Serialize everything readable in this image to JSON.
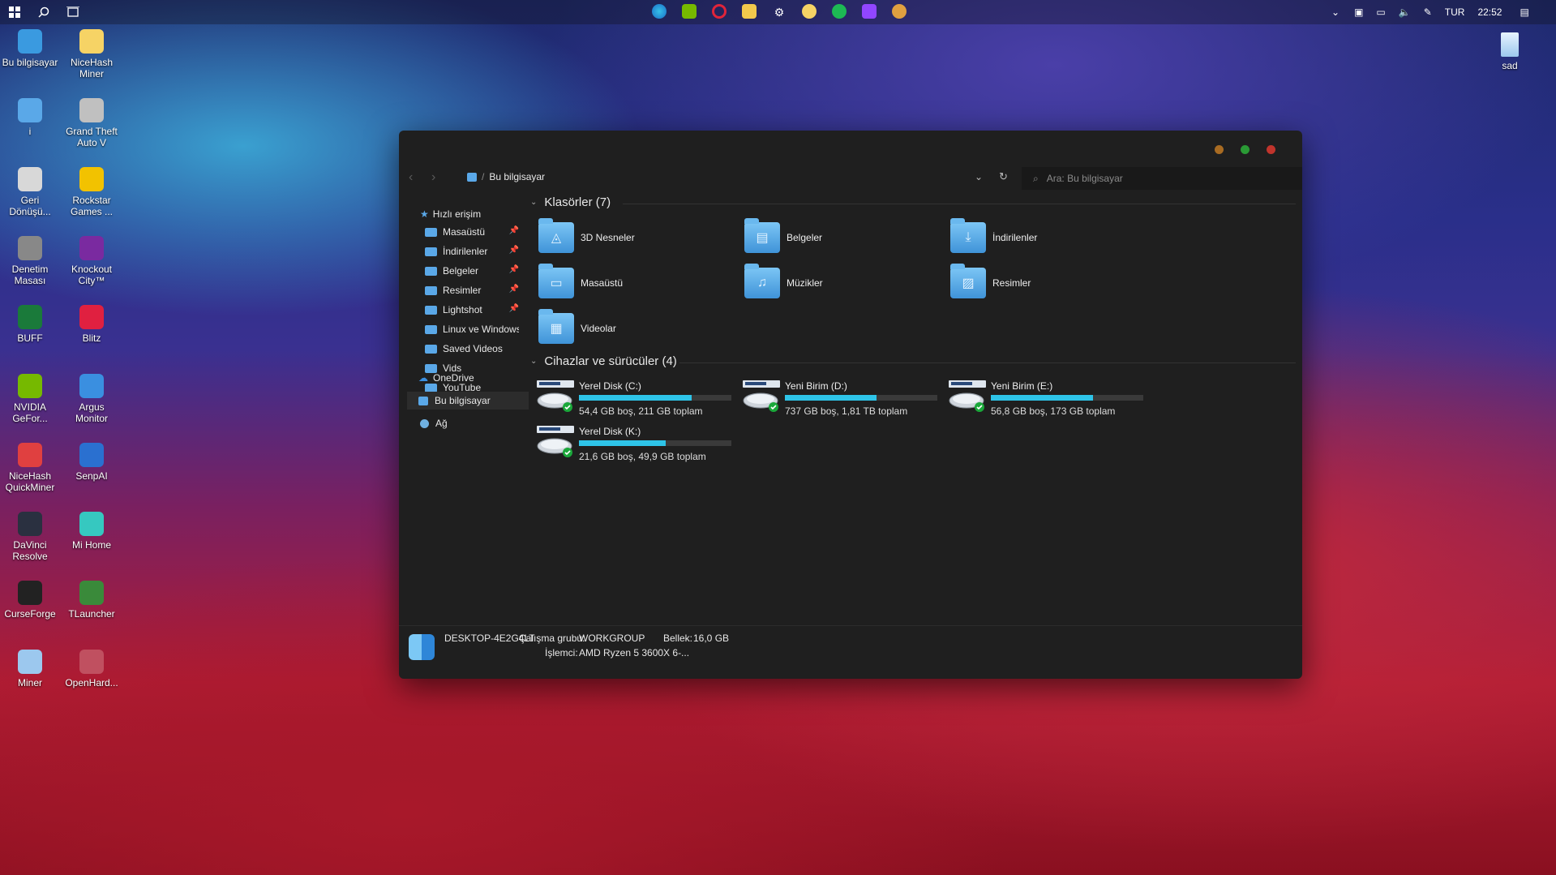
{
  "taskbar": {
    "tray": {
      "language": "TUR",
      "time": "22:52"
    }
  },
  "desktop_left": [
    {
      "label": "Bu bilgisayar",
      "icon": "monitor-icon"
    },
    {
      "label": "NiceHash Miner",
      "icon": "nicehash-icon"
    },
    {
      "label": "i",
      "icon": "user-folder-icon"
    },
    {
      "label": "Grand Theft Auto V",
      "icon": "gta-icon"
    },
    {
      "label": "Geri Dönüşü...",
      "icon": "recycle-bin-icon"
    },
    {
      "label": "Rockstar Games ...",
      "icon": "rockstar-icon"
    },
    {
      "label": "Denetim Masası",
      "icon": "control-panel-icon"
    },
    {
      "label": "Knockout City™",
      "icon": "knockout-city-icon"
    },
    {
      "label": "BUFF",
      "icon": "buff-icon"
    },
    {
      "label": "Blitz",
      "icon": "blitz-icon"
    },
    {
      "label": "NVIDIA GeFor...",
      "icon": "nvidia-icon"
    },
    {
      "label": "Argus Monitor",
      "icon": "argus-icon"
    },
    {
      "label": "NiceHash QuickMiner",
      "icon": "quickminer-icon"
    },
    {
      "label": "SenpAI",
      "icon": "senpai-icon"
    },
    {
      "label": "DaVinci Resolve",
      "icon": "davinci-icon"
    },
    {
      "label": "Mi Home",
      "icon": "mihome-icon"
    },
    {
      "label": "CurseForge",
      "icon": "curseforge-icon"
    },
    {
      "label": "TLauncher",
      "icon": "tlauncher-icon"
    },
    {
      "label": "Miner",
      "icon": "file-icon"
    },
    {
      "label": "OpenHard...",
      "icon": "openhardware-icon"
    }
  ],
  "desktop_right": [
    {
      "label": "sad",
      "icon": "document-icon"
    }
  ],
  "explorer": {
    "breadcrumb": "Bu bilgisayar",
    "search_placeholder": "Ara: Bu bilgisayar",
    "sidebar": {
      "quick_access": "Hızlı erişim",
      "quick_items": [
        {
          "label": "Masaüstü",
          "pinned": true
        },
        {
          "label": "İndirilenler",
          "pinned": true
        },
        {
          "label": "Belgeler",
          "pinned": true
        },
        {
          "label": "Resimler",
          "pinned": true
        },
        {
          "label": "Lightshot",
          "pinned": true
        },
        {
          "label": "Linux ve Windows i",
          "pinned": false
        },
        {
          "label": "Saved Videos",
          "pinned": false
        },
        {
          "label": "Vids",
          "pinned": false
        },
        {
          "label": "YouTube",
          "pinned": false
        }
      ],
      "onedrive": "OneDrive",
      "this_pc": "Bu bilgisayar",
      "network": "Ağ"
    },
    "folders_header": "Klasörler (7)",
    "folders": [
      {
        "label": "3D Nesneler",
        "glyph": "◬"
      },
      {
        "label": "Belgeler",
        "glyph": "▤"
      },
      {
        "label": "İndirilenler",
        "glyph": "⤓"
      },
      {
        "label": "Masaüstü",
        "glyph": "▭"
      },
      {
        "label": "Müzikler",
        "glyph": "♫"
      },
      {
        "label": "Resimler",
        "glyph": "▨"
      },
      {
        "label": "Videolar",
        "glyph": "▦"
      }
    ],
    "drives_header": "Cihazlar ve sürücüler (4)",
    "drives": [
      {
        "name": "Yerel Disk (C:)",
        "free": "54,4 GB boş, 211 GB toplam",
        "used_fraction": 0.74
      },
      {
        "name": "Yeni Birim (D:)",
        "free": "737 GB boş, 1,81 TB toplam",
        "used_fraction": 0.6
      },
      {
        "name": "Yeni Birim (E:)",
        "free": "56,8 GB boş, 173 GB toplam",
        "used_fraction": 0.67
      },
      {
        "name": "Yerel Disk (K:)",
        "free": "21,6 GB boş, 49,9 GB toplam",
        "used_fraction": 0.57
      }
    ],
    "status": {
      "computer_name": "DESKTOP-4E2G4LT",
      "workgroup_label": "Çalışma grubu:",
      "workgroup": "WORKGROUP",
      "memory_label": "Bellek:",
      "memory": "16,0 GB",
      "cpu_label": "İşlemci:",
      "cpu": "AMD Ryzen 5 3600X 6-..."
    }
  }
}
